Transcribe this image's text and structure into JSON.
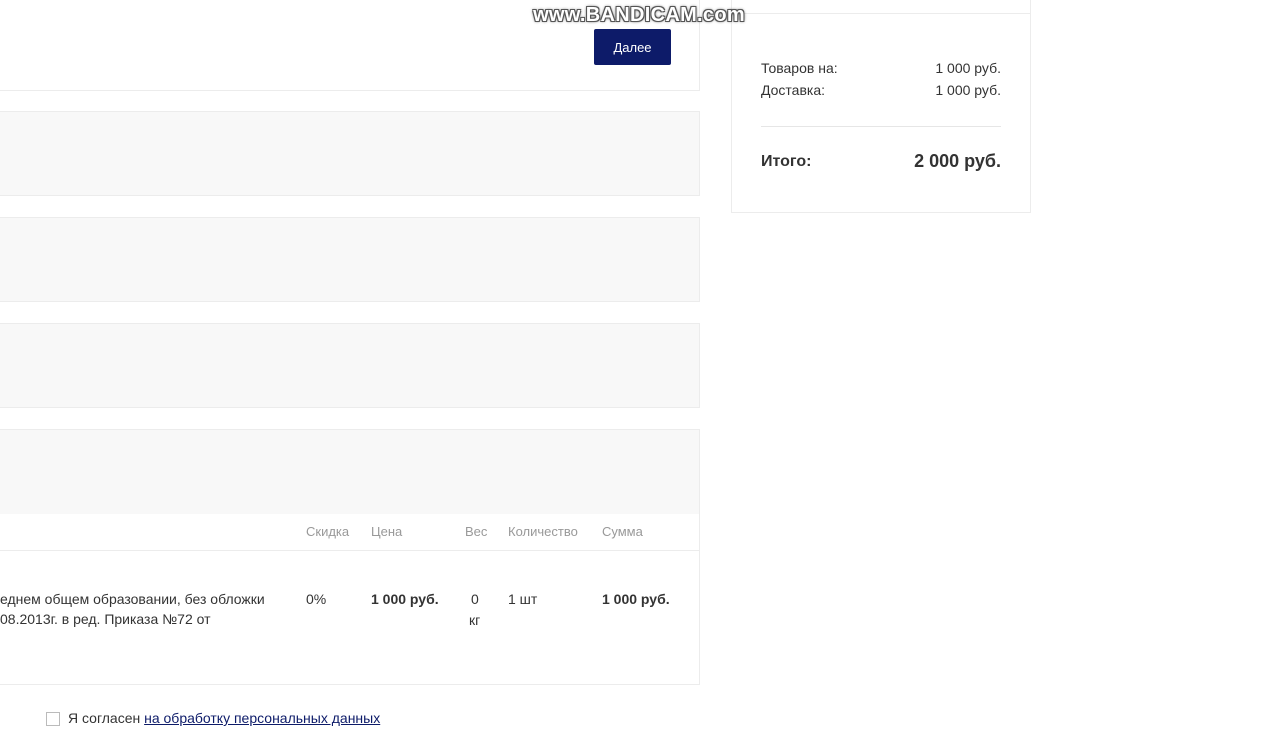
{
  "watermark": "www.BANDICAM.com",
  "step": {
    "next_button": "Далее"
  },
  "summary": {
    "goods_label": "Товаров на:",
    "goods_value": "1 000 руб.",
    "delivery_label": "Доставка:",
    "delivery_value": "1 000 руб.",
    "total_label": "Итого:",
    "total_value": "2 000 руб."
  },
  "table": {
    "headers": [
      "Скидка",
      "Цена",
      "Вес",
      "Количество",
      "Сумма"
    ],
    "row": {
      "name_line1": "еднем общем образовании, без обложки",
      "name_line2": "08.2013г. в ред. Приказа №72 от",
      "discount": "0%",
      "price": "1 000 руб.",
      "weight_value": "0",
      "weight_unit": "кг",
      "quantity": "1 шт",
      "sum": "1 000 руб."
    }
  },
  "consent": {
    "prefix": "Я согласен ",
    "link": "на обработку персональных данных"
  }
}
